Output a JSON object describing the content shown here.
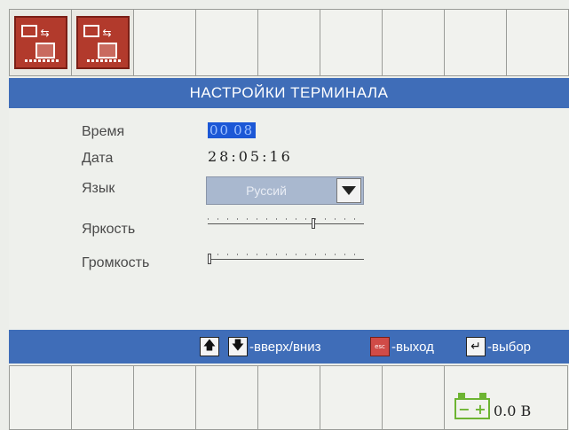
{
  "title": "НАСТРОЙКИ ТЕРМИНАЛА",
  "settings": {
    "time_label": "Время",
    "time_hours": "00",
    "time_minutes": "08",
    "date_label": "Дата",
    "date_value": "28:05:16",
    "language_label": "Язык",
    "language_value": "Руссий",
    "brightness_label": "Яркость",
    "brightness_level": 0.68,
    "volume_label": "Громкость",
    "volume_level": 0.0
  },
  "help": {
    "updown": "-вверх/вниз",
    "exit": "-выход",
    "select": "-выбор",
    "esc_key": "esc"
  },
  "status": {
    "voltage": "0.0 В"
  },
  "colors": {
    "title_bar": "#3f6db8",
    "time_highlight": "#1c58d6",
    "battery": "#6db432",
    "icon_red": "#b23a2c"
  },
  "icons": [
    "terminal-settings-icon",
    "display-settings-icon",
    "up-arrow-icon",
    "down-arrow-icon",
    "esc-icon",
    "enter-icon",
    "battery-icon",
    "dropdown-arrow-icon"
  ]
}
